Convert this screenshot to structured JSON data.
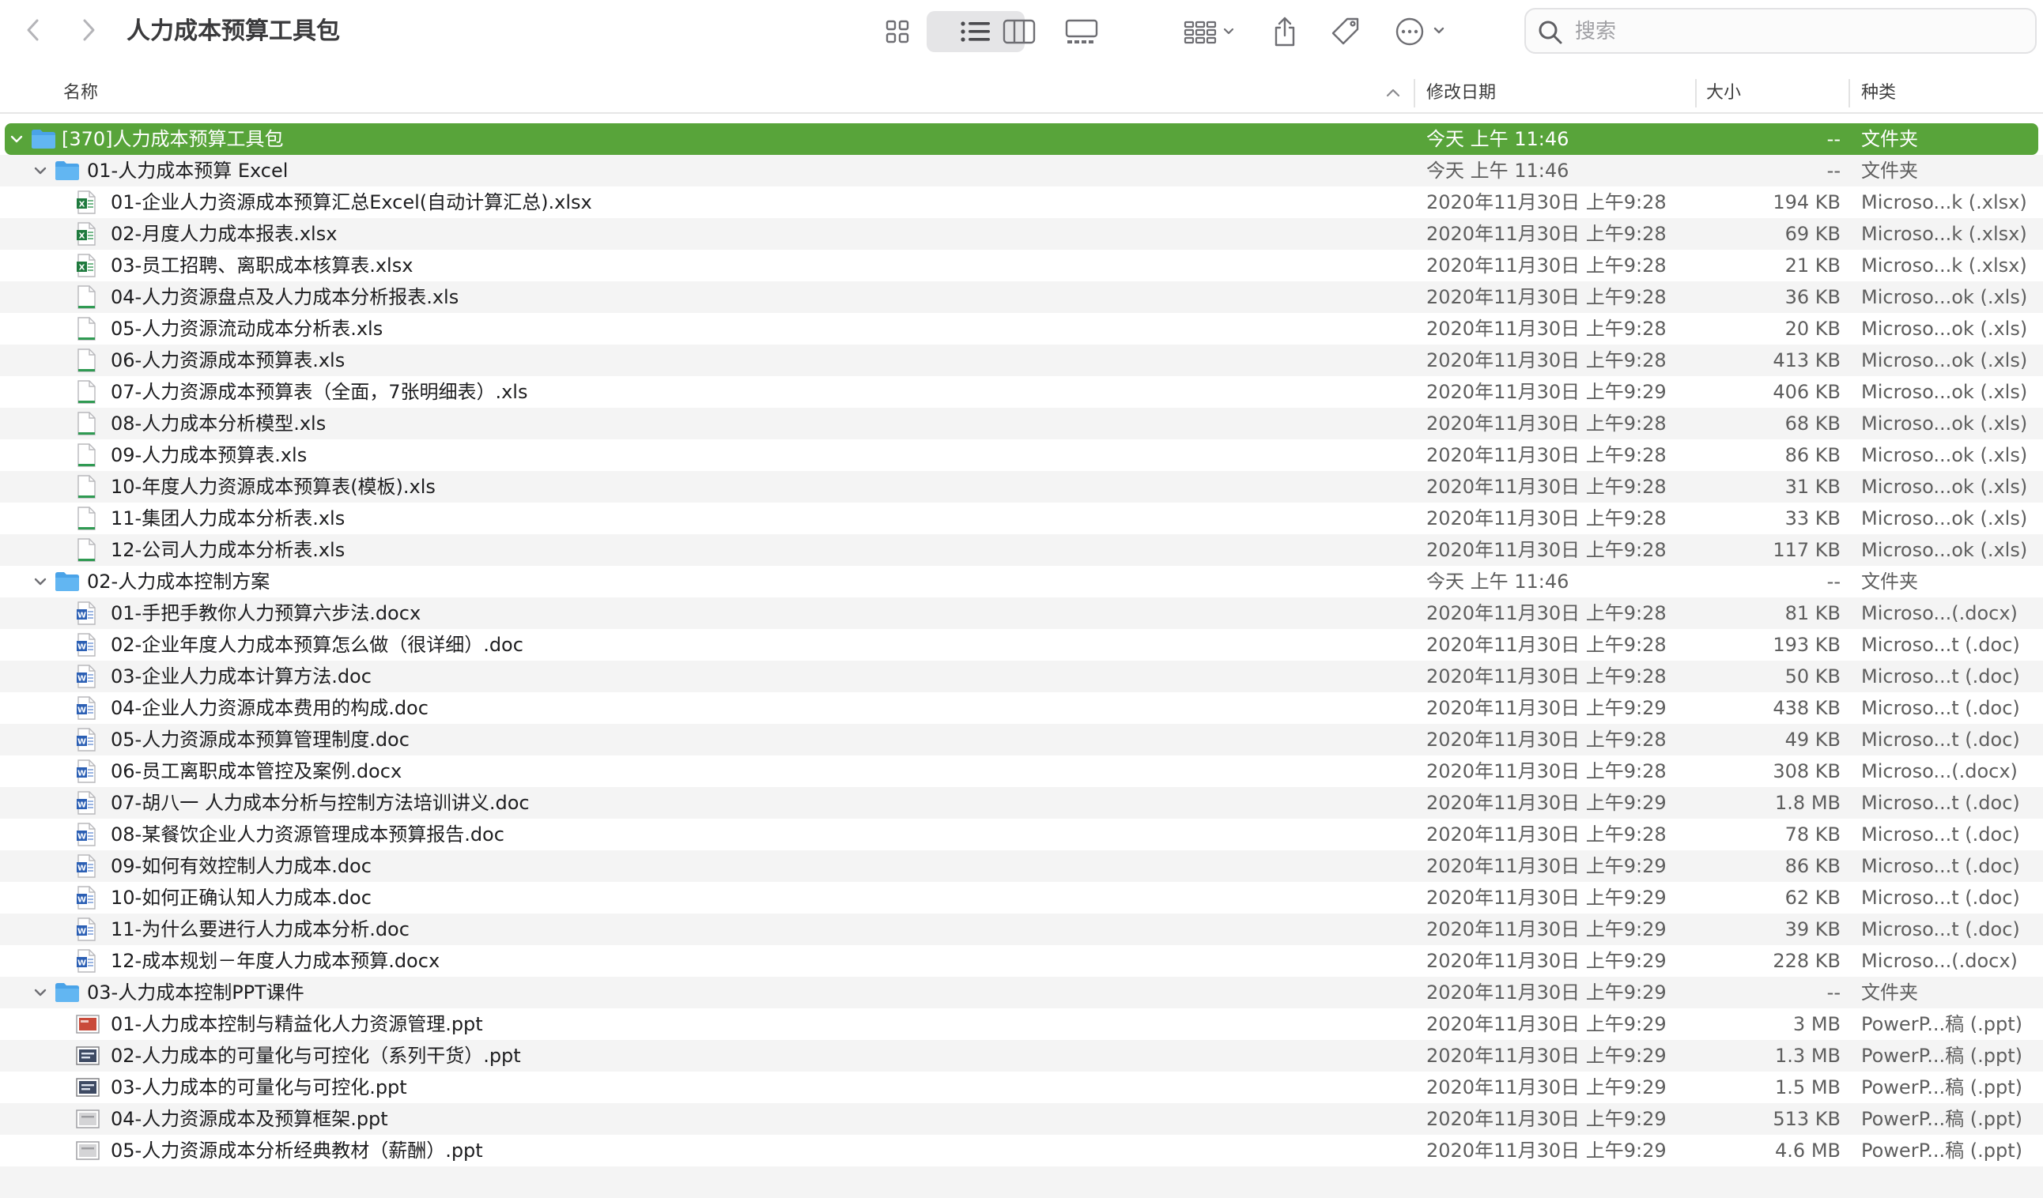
{
  "window": {
    "title": "人力成本预算工具包",
    "search_placeholder": "搜索"
  },
  "toolbar_icons": [
    "back-icon",
    "forward-icon",
    "icon-view-icon",
    "list-view-icon",
    "column-view-icon",
    "gallery-view-icon",
    "group-icon",
    "share-icon",
    "tag-icon",
    "more-icon",
    "search-icon"
  ],
  "columns": {
    "name": "名称",
    "date": "修改日期",
    "size": "大小",
    "kind": "种类"
  },
  "rows": [
    {
      "level": 0,
      "type": "folder",
      "expanded": true,
      "selected": true,
      "name": "[370]人力成本预算工具包",
      "date": "今天 上午 11:46",
      "size": "--",
      "kind": "文件夹"
    },
    {
      "level": 1,
      "type": "folder",
      "expanded": true,
      "name": "01-人力成本预算 Excel",
      "date": "今天 上午 11:46",
      "size": "--",
      "kind": "文件夹"
    },
    {
      "level": 2,
      "type": "xlsx",
      "name": "01-企业人力资源成本预算汇总Excel(自动计算汇总).xlsx",
      "date": "2020年11月30日 上午9:28",
      "size": "194 KB",
      "kind": "Microso...k (.xlsx)"
    },
    {
      "level": 2,
      "type": "xlsx",
      "name": "02-月度人力成本报表.xlsx",
      "date": "2020年11月30日 上午9:28",
      "size": "69 KB",
      "kind": "Microso...k (.xlsx)"
    },
    {
      "level": 2,
      "type": "xlsx",
      "name": "03-员工招聘、离职成本核算表.xlsx",
      "date": "2020年11月30日 上午9:28",
      "size": "21 KB",
      "kind": "Microso...k (.xlsx)"
    },
    {
      "level": 2,
      "type": "xls",
      "name": "04-人力资源盘点及人力成本分析报表.xls",
      "date": "2020年11月30日 上午9:28",
      "size": "36 KB",
      "kind": "Microso...ok (.xls)"
    },
    {
      "level": 2,
      "type": "xls",
      "name": "05-人力资源流动成本分析表.xls",
      "date": "2020年11月30日 上午9:28",
      "size": "20 KB",
      "kind": "Microso...ok (.xls)"
    },
    {
      "level": 2,
      "type": "xls",
      "name": "06-人力资源成本预算表.xls",
      "date": "2020年11月30日 上午9:28",
      "size": "413 KB",
      "kind": "Microso...ok (.xls)"
    },
    {
      "level": 2,
      "type": "xls",
      "name": "07-人力资源成本预算表（全面，7张明细表）.xls",
      "date": "2020年11月30日 上午9:29",
      "size": "406 KB",
      "kind": "Microso...ok (.xls)"
    },
    {
      "level": 2,
      "type": "xls",
      "name": "08-人力成本分析模型.xls",
      "date": "2020年11月30日 上午9:28",
      "size": "68 KB",
      "kind": "Microso...ok (.xls)"
    },
    {
      "level": 2,
      "type": "xls",
      "name": "09-人力成本预算表.xls",
      "date": "2020年11月30日 上午9:28",
      "size": "86 KB",
      "kind": "Microso...ok (.xls)"
    },
    {
      "level": 2,
      "type": "xls",
      "name": "10-年度人力资源成本预算表(模板).xls",
      "date": "2020年11月30日 上午9:28",
      "size": "31 KB",
      "kind": "Microso...ok (.xls)"
    },
    {
      "level": 2,
      "type": "xls",
      "name": "11-集团人力成本分析表.xls",
      "date": "2020年11月30日 上午9:28",
      "size": "33 KB",
      "kind": "Microso...ok (.xls)"
    },
    {
      "level": 2,
      "type": "xls",
      "name": "12-公司人力成本分析表.xls",
      "date": "2020年11月30日 上午9:28",
      "size": "117 KB",
      "kind": "Microso...ok (.xls)"
    },
    {
      "level": 1,
      "type": "folder",
      "expanded": true,
      "name": "02-人力成本控制方案",
      "date": "今天 上午 11:46",
      "size": "--",
      "kind": "文件夹"
    },
    {
      "level": 2,
      "type": "docx",
      "name": "01-手把手教你人力预算六步法.docx",
      "date": "2020年11月30日 上午9:28",
      "size": "81 KB",
      "kind": "Microso...(.docx)"
    },
    {
      "level": 2,
      "type": "doc",
      "name": "02-企业年度人力成本预算怎么做（很详细）.doc",
      "date": "2020年11月30日 上午9:28",
      "size": "193 KB",
      "kind": "Microso...t (.doc)"
    },
    {
      "level": 2,
      "type": "doc",
      "name": "03-企业人力成本计算方法.doc",
      "date": "2020年11月30日 上午9:28",
      "size": "50 KB",
      "kind": "Microso...t (.doc)"
    },
    {
      "level": 2,
      "type": "doc",
      "name": "04-企业人力资源成本费用的构成.doc",
      "date": "2020年11月30日 上午9:29",
      "size": "438 KB",
      "kind": "Microso...t (.doc)"
    },
    {
      "level": 2,
      "type": "doc",
      "name": "05-人力资源成本预算管理制度.doc",
      "date": "2020年11月30日 上午9:28",
      "size": "49 KB",
      "kind": "Microso...t (.doc)"
    },
    {
      "level": 2,
      "type": "docx",
      "name": "06-员工离职成本管控及案例.docx",
      "date": "2020年11月30日 上午9:28",
      "size": "308 KB",
      "kind": "Microso...(.docx)"
    },
    {
      "level": 2,
      "type": "doc",
      "name": "07-胡八一 人力成本分析与控制方法培训讲义.doc",
      "date": "2020年11月30日 上午9:29",
      "size": "1.8 MB",
      "kind": "Microso...t (.doc)"
    },
    {
      "level": 2,
      "type": "doc",
      "name": "08-某餐饮企业人力资源管理成本预算报告.doc",
      "date": "2020年11月30日 上午9:28",
      "size": "78 KB",
      "kind": "Microso...t (.doc)"
    },
    {
      "level": 2,
      "type": "doc",
      "name": "09-如何有效控制人力成本.doc",
      "date": "2020年11月30日 上午9:29",
      "size": "86 KB",
      "kind": "Microso...t (.doc)"
    },
    {
      "level": 2,
      "type": "doc",
      "name": "10-如何正确认知人力成本.doc",
      "date": "2020年11月30日 上午9:29",
      "size": "62 KB",
      "kind": "Microso...t (.doc)"
    },
    {
      "level": 2,
      "type": "doc",
      "name": "11-为什么要进行人力成本分析.doc",
      "date": "2020年11月30日 上午9:29",
      "size": "39 KB",
      "kind": "Microso...t (.doc)"
    },
    {
      "level": 2,
      "type": "docx",
      "name": "12-成本规划－年度人力成本预算.docx",
      "date": "2020年11月30日 上午9:29",
      "size": "228 KB",
      "kind": "Microso...(.docx)"
    },
    {
      "level": 1,
      "type": "folder",
      "expanded": true,
      "name": "03-人力成本控制PPT课件",
      "date": "2020年11月30日 上午9:29",
      "size": "--",
      "kind": "文件夹"
    },
    {
      "level": 2,
      "type": "ppt-red",
      "name": "01-人力成本控制与精益化人力资源管理.ppt",
      "date": "2020年11月30日 上午9:29",
      "size": "3 MB",
      "kind": "PowerP...稿 (.ppt)"
    },
    {
      "level": 2,
      "type": "ppt-dark",
      "name": "02-人力成本的可量化与可控化（系列干货）.ppt",
      "date": "2020年11月30日 上午9:29",
      "size": "1.3 MB",
      "kind": "PowerP...稿 (.ppt)"
    },
    {
      "level": 2,
      "type": "ppt-dark",
      "name": "03-人力成本的可量化与可控化.ppt",
      "date": "2020年11月30日 上午9:29",
      "size": "1.5 MB",
      "kind": "PowerP...稿 (.ppt)"
    },
    {
      "level": 2,
      "type": "ppt-gray",
      "name": "04-人力资源成本及预算框架.ppt",
      "date": "2020年11月30日 上午9:29",
      "size": "513 KB",
      "kind": "PowerP...稿 (.ppt)"
    },
    {
      "level": 2,
      "type": "ppt-gray",
      "name": "05-人力资源成本分析经典教材（薪酬）.ppt",
      "date": "2020年11月30日 上午9:29",
      "size": "4.6 MB",
      "kind": "PowerP...稿 (.ppt)"
    },
    {
      "level": -1,
      "type": "empty",
      "name": "",
      "date": "",
      "size": "",
      "kind": ""
    }
  ]
}
